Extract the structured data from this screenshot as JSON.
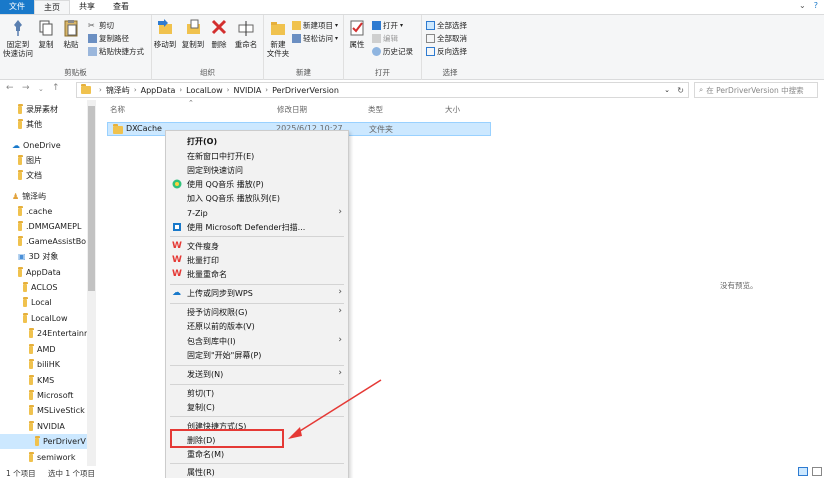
{
  "tabs": [
    {
      "label": "文件"
    },
    {
      "label": "主页"
    },
    {
      "label": "共享"
    },
    {
      "label": "查看"
    }
  ],
  "ribbon": {
    "clipboard": {
      "pin_label_1": "固定到",
      "pin_label_2": "快速访问",
      "copy": "复制",
      "paste": "粘贴",
      "cut": "剪切",
      "copy_path": "复制路径",
      "paste_shortcut": "粘贴快捷方式",
      "group": "剪贴板"
    },
    "organize": {
      "move_to": "移动到",
      "copy_to": "复制到",
      "delete": "删除",
      "rename": "重命名",
      "group": "组织"
    },
    "new": {
      "new_folder_1": "新建",
      "new_folder_2": "文件夹",
      "new_item": "新建项目",
      "easy_access": "轻松访问",
      "group": "新建"
    },
    "open": {
      "properties": "属性",
      "open": "打开",
      "edit": "编辑",
      "history": "历史记录",
      "group": "打开"
    },
    "select": {
      "select_all": "全部选择",
      "select_none": "全部取消",
      "invert": "反向选择",
      "group": "选择"
    }
  },
  "address": {
    "crumbs": [
      "锦泽屿",
      "AppData",
      "LocalLow",
      "NVIDIA",
      "PerDriverVersion"
    ],
    "search_placeholder": "在 PerDriverVersion 中搜索"
  },
  "nav": {
    "items": [
      {
        "label": "录屏素材"
      },
      {
        "label": "其他"
      },
      {
        "label": "OneDrive"
      },
      {
        "label": "图片"
      },
      {
        "label": "文档"
      },
      {
        "label": "锦泽屿"
      },
      {
        "label": ".cache"
      },
      {
        "label": ".DMMGAMEPL"
      },
      {
        "label": ".GameAssistBo"
      },
      {
        "label": "3D 对象"
      },
      {
        "label": "AppData"
      },
      {
        "label": "ACLOS"
      },
      {
        "label": "Local"
      },
      {
        "label": "LocalLow"
      },
      {
        "label": "24Entertainm"
      },
      {
        "label": "AMD"
      },
      {
        "label": "biliHK"
      },
      {
        "label": "KMS"
      },
      {
        "label": "Microsoft"
      },
      {
        "label": "MSLiveStick"
      },
      {
        "label": "NVIDIA"
      },
      {
        "label": "PerDriverV"
      },
      {
        "label": "semiwork"
      }
    ]
  },
  "columns": {
    "name": "名称",
    "date": "修改日期",
    "type": "类型",
    "size": "大小"
  },
  "files": [
    {
      "name": "DXCache",
      "date": "2025/6/12 10:27",
      "type": "文件夹"
    }
  ],
  "preview_text": "没有预览。",
  "status": {
    "count": "1 个项目",
    "selected": "选中 1 个项目"
  },
  "context_menu": {
    "items": [
      {
        "label": "打开(O)"
      },
      {
        "label": "在新窗口中打开(E)"
      },
      {
        "label": "固定到快速访问"
      },
      {
        "label": "使用 QQ音乐 播放(P)"
      },
      {
        "label": "加入 QQ音乐 播放队列(E)"
      },
      {
        "label": "7-Zip"
      },
      {
        "label": "使用 Microsoft Defender扫描..."
      },
      {
        "label": "文件瘦身"
      },
      {
        "label": "批量打印"
      },
      {
        "label": "批量重命名"
      },
      {
        "label": "上传或同步到WPS"
      },
      {
        "label": "授予访问权限(G)"
      },
      {
        "label": "还原以前的版本(V)"
      },
      {
        "label": "包含到库中(I)"
      },
      {
        "label": "固定到\"开始\"屏幕(P)"
      },
      {
        "label": "发送到(N)"
      },
      {
        "label": "剪切(T)"
      },
      {
        "label": "复制(C)"
      },
      {
        "label": "创建快捷方式(S)"
      },
      {
        "label": "删除(D)"
      },
      {
        "label": "重命名(M)"
      },
      {
        "label": "属性(R)"
      }
    ]
  },
  "colors": {
    "accent": "#1979ca",
    "selection": "#cce8ff",
    "annotation": "#e53935"
  }
}
